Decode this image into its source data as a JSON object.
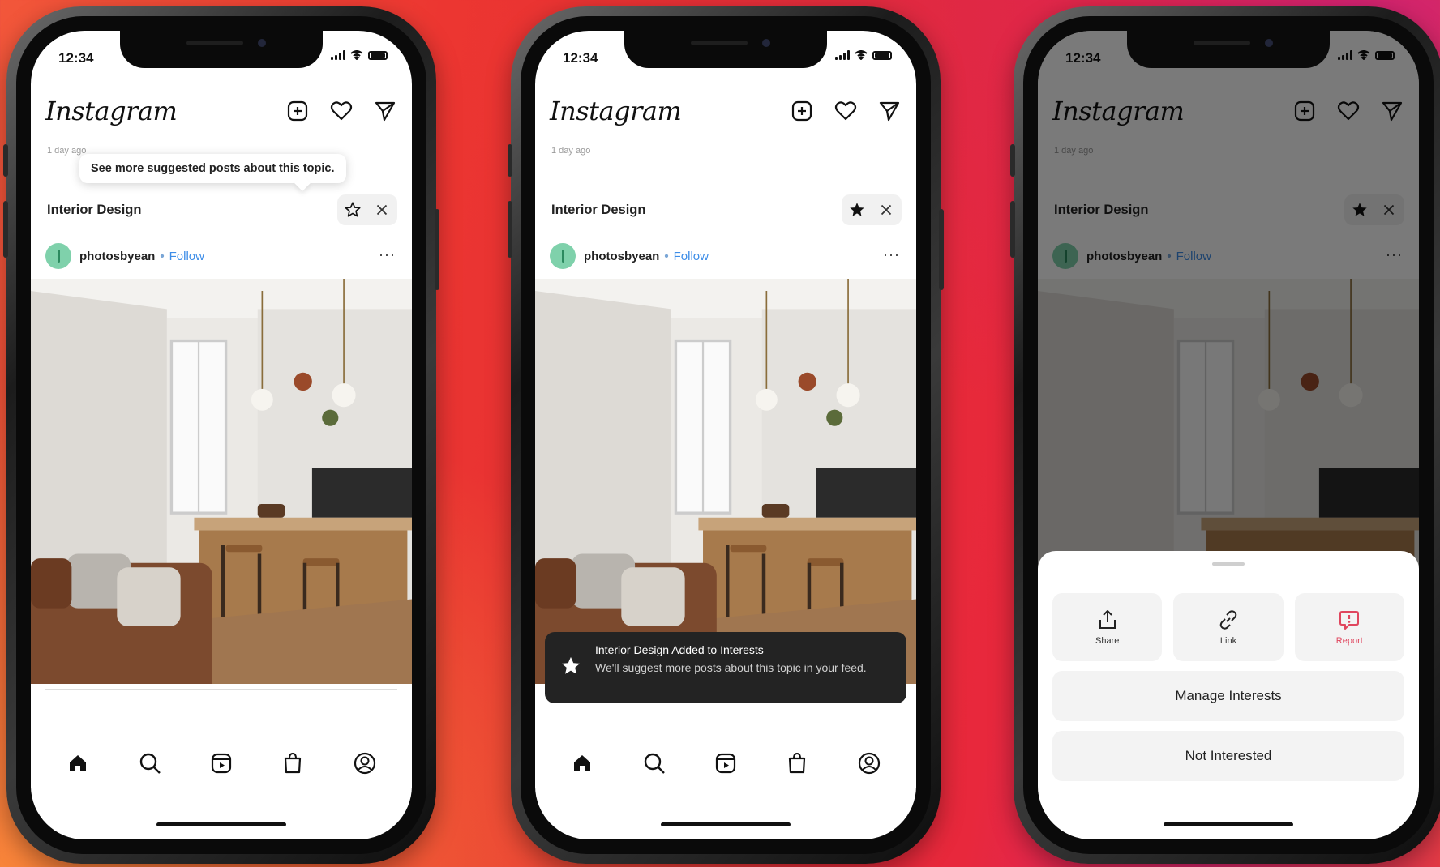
{
  "status": {
    "time": "12:34"
  },
  "app": {
    "logo": "Instagram"
  },
  "header_icons": [
    "plus-square-icon",
    "heart-icon",
    "send-icon"
  ],
  "post": {
    "time_ago": "1 day ago",
    "topic": "Interior Design",
    "username": "photosbyean",
    "follow_label": "Follow",
    "more_label": "···"
  },
  "screens": [
    {
      "tooltip": "See more suggested posts about this topic.",
      "star_filled": false
    },
    {
      "star_filled": true,
      "toast": {
        "title": "Interior Design Added to Interests",
        "body": "We'll suggest more posts about this topic in your feed."
      }
    },
    {
      "star_filled": true,
      "sheet": {
        "tiles": [
          {
            "label": "Share",
            "icon": "share-icon"
          },
          {
            "label": "Link",
            "icon": "link-icon"
          },
          {
            "label": "Report",
            "icon": "report-icon"
          }
        ],
        "manage_label": "Manage Interests",
        "not_interested_label": "Not Interested"
      }
    }
  ],
  "tabbar": [
    "home-icon",
    "search-icon",
    "reels-icon",
    "shop-icon",
    "profile-icon"
  ],
  "colors": {
    "follow": "#3d8de8",
    "avatar": "#7fd1ab",
    "report": "#e0465e",
    "toast_bg": "#232323"
  }
}
